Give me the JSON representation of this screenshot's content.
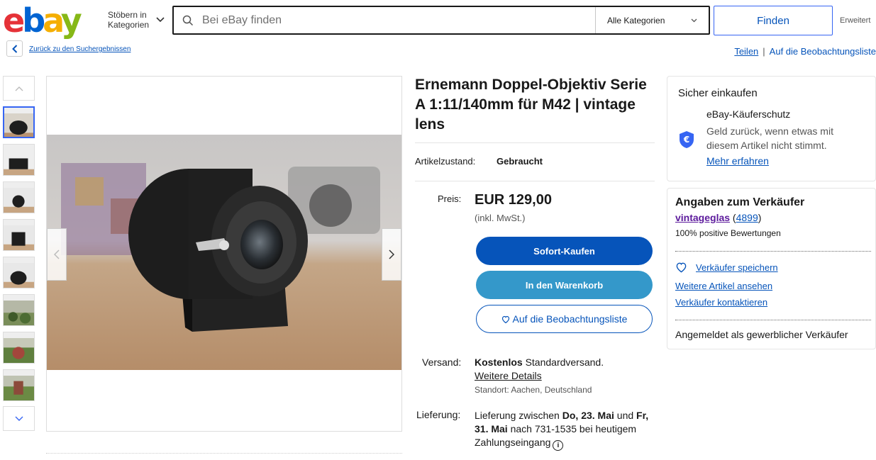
{
  "header": {
    "logo_letters": [
      "e",
      "b",
      "a",
      "y"
    ],
    "browse_line1": "Stöbern in",
    "browse_line2": "Kategorien",
    "search_placeholder": "Bei eBay finden",
    "category_value": "Alle Kategorien",
    "find_label": "Finden",
    "advanced_label": "Erweitert"
  },
  "nav": {
    "back_link": "Zurück zu den Suchergebnissen",
    "share_link": "Teilen",
    "separator": "|",
    "watchlist_link": "Auf die Beobachtungsliste"
  },
  "product": {
    "title": "Ernemann Doppel-Objektiv Serie A 1:11/140mm für M42 | vintage lens",
    "condition_label": "Artikelzustand:",
    "condition_value": "Gebraucht",
    "price_label": "Preis:",
    "price": "EUR 129,00",
    "tax_note": "(inkl. MwSt.)",
    "buy_now": "Sofort-Kaufen",
    "add_to_cart": "In den Warenkorb",
    "add_to_watchlist": "Auf die Beobachtungsliste",
    "shipping_label": "Versand:",
    "shipping_free": "Kostenlos",
    "shipping_type": "Standardversand.",
    "shipping_details": "Weitere Details",
    "shipping_location": "Standort: Aachen, Deutschland",
    "delivery_label": "Lieferung:",
    "delivery_prefix": "Lieferung zwischen",
    "delivery_date1": "Do, 23. Mai",
    "delivery_and": "und",
    "delivery_date2": "Fr, 31. Mai",
    "delivery_suffix": "nach 731-1535 bei heutigem Zahlungseingang"
  },
  "buyer_protection": {
    "title": "Sicher einkaufen",
    "head": "eBay-Käuferschutz",
    "desc": "Geld zurück, wenn etwas mit diesem Artikel nicht stimmt.",
    "link": "Mehr erfahren"
  },
  "seller": {
    "title": "Angaben zum Verkäufer",
    "name": "vintageglas",
    "feedback_count": "4899",
    "positive": "100% positive Bewertungen",
    "save_seller": "Verkäufer speichern",
    "more_items": "Weitere Artikel ansehen",
    "contact": "Verkäufer kontaktieren",
    "commercial": "Angemeldet als gewerblicher Verkäufer"
  },
  "colors": {
    "primary_blue": "#0654ba",
    "cart_blue": "#3498ca",
    "seller_purple": "#5c1a9c"
  }
}
